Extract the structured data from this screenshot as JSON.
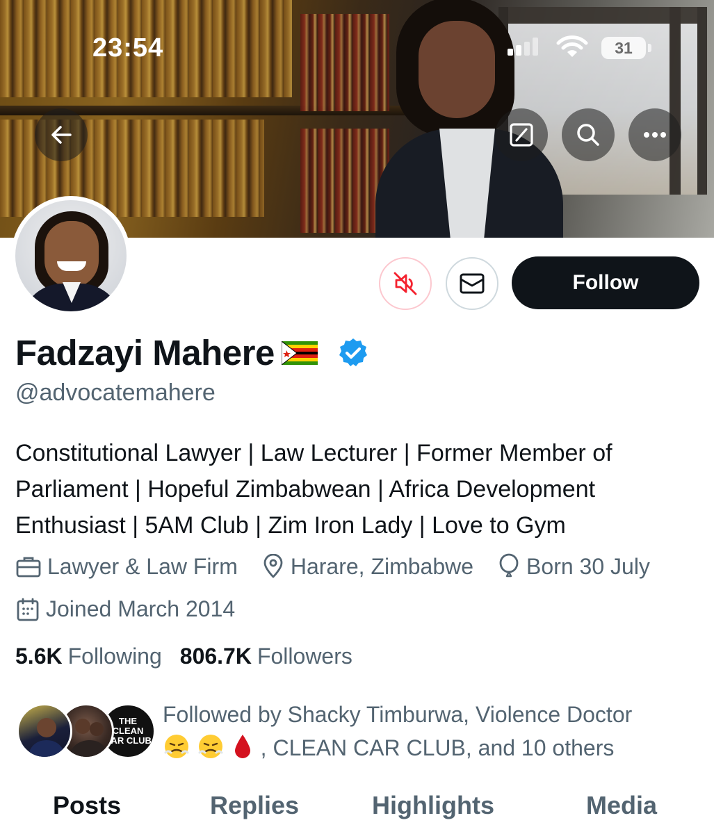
{
  "status_bar": {
    "time": "23:54",
    "battery": "31"
  },
  "profile": {
    "name": "Fadzayi Mahere",
    "handle": "@advocatemahere",
    "bio": "Constitutional Lawyer | Law Lecturer | Former Member of Parliament | Hopeful Zimbabwean | Africa Development Enthusiast | 5AM Club | Zim Iron Lady | Love to Gym",
    "category": "Lawyer & Law Firm",
    "location": "Harare, Zimbabwe",
    "birthday": "Born 30 July",
    "joined": "Joined March 2014"
  },
  "stats": {
    "following_count": "5.6K",
    "following_label": "Following",
    "followers_count": "806.7K",
    "followers_label": "Followers"
  },
  "actions": {
    "follow_label": "Follow"
  },
  "followed_by": {
    "line1": "Followed by Shacky Timburwa, Violence Doctor",
    "line2": ", CLEAN CAR CLUB, and 10 others",
    "club_avatar_text": "THE CLEAN CAR CLUB"
  },
  "tabs": [
    "Posts",
    "Replies",
    "Highlights",
    "Media"
  ],
  "colors": {
    "verified": "#1d9bf0",
    "muted_red": "#f4212e",
    "primary_text": "#0f1419",
    "secondary_text": "#536471"
  },
  "icons": {
    "back": "arrow-left-icon",
    "grok": "grok-icon",
    "search": "search-icon",
    "more": "more-icon",
    "muted": "muted-speaker-icon",
    "message": "envelope-icon",
    "verified": "verified-badge-icon",
    "category": "briefcase-icon",
    "location": "location-pin-icon",
    "birthday": "balloon-icon",
    "joined": "calendar-icon"
  }
}
